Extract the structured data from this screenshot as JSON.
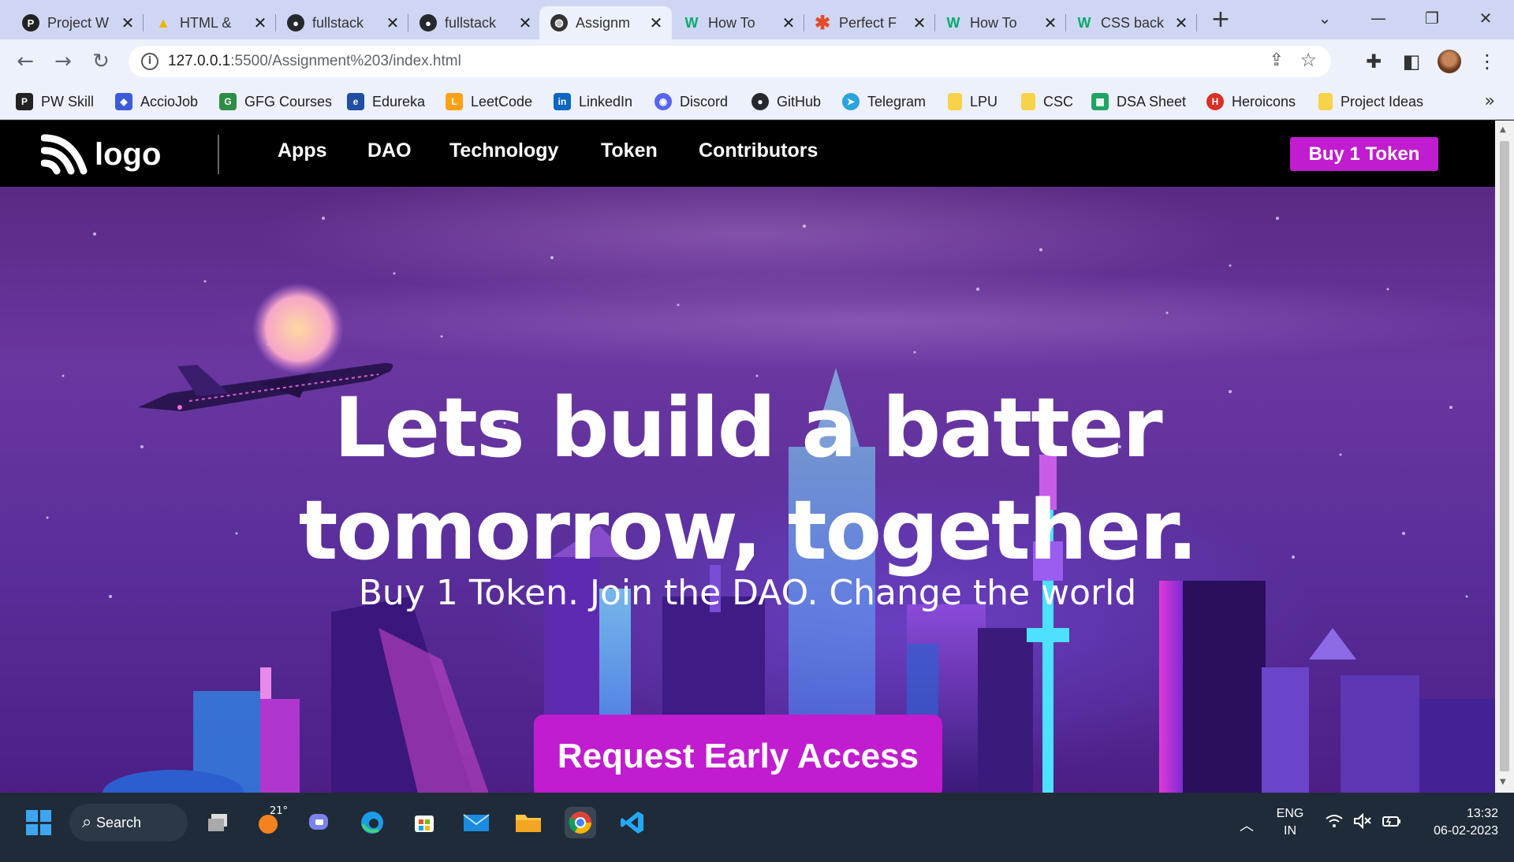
{
  "browser": {
    "tabs": [
      {
        "label": "Project W",
        "icon": "pw-skills-icon",
        "icon_bg": "#222222"
      },
      {
        "label": "HTML &",
        "icon": "google-drive-icon",
        "icon_bg": "#f4b400"
      },
      {
        "label": "fullstack",
        "icon": "github-icon",
        "icon_bg": "#24292e"
      },
      {
        "label": "fullstack",
        "icon": "github-icon",
        "icon_bg": "#24292e"
      },
      {
        "label": "Assignm",
        "icon": "globe-icon",
        "icon_bg": "#333333",
        "active": true
      },
      {
        "label": "How To",
        "icon": "w3schools-icon",
        "icon_bg": "#04aa6d"
      },
      {
        "label": "Perfect F",
        "icon": "asterisk-icon",
        "icon_bg": "#e34c26"
      },
      {
        "label": "How To",
        "icon": "w3schools-icon",
        "icon_bg": "#04aa6d"
      },
      {
        "label": "CSS back",
        "icon": "w3schools-icon",
        "icon_bg": "#04aa6d"
      }
    ],
    "new_tab": "+",
    "url_host": "127.0.0.1",
    "url_path": ":5500/Assignment%203/index.html",
    "bookmarks": [
      {
        "label": "PW Skill",
        "icon_bg": "#222222"
      },
      {
        "label": "AccioJob",
        "icon_bg": "#3b5bdb"
      },
      {
        "label": "GFG Courses",
        "icon_bg": "#2f8d46"
      },
      {
        "label": "Edureka",
        "icon_bg": "#1f4ea3"
      },
      {
        "label": "LeetCode",
        "icon_bg": "#ffa116"
      },
      {
        "label": "LinkedIn",
        "icon_bg": "#0a66c2"
      },
      {
        "label": "Discord",
        "icon_bg": "#5865f2"
      },
      {
        "label": "GitHub",
        "icon_bg": "#24292e"
      },
      {
        "label": "Telegram",
        "icon_bg": "#2aa3e0"
      },
      {
        "label": "LPU",
        "icon_bg": "#f7d24b"
      },
      {
        "label": "CSC",
        "icon_bg": "#f7d24b"
      },
      {
        "label": "DSA Sheet",
        "icon_bg": "#1fa463"
      },
      {
        "label": "Heroicons",
        "icon_bg": "#d93025"
      },
      {
        "label": "Project Ideas",
        "icon_bg": "#f7d24b"
      }
    ],
    "bookmarks_more": "»"
  },
  "site": {
    "logo_text": "logo",
    "nav": [
      "Apps",
      "DAO",
      "Technology",
      "Token",
      "Contributors"
    ],
    "buy_button": "Buy 1 Token",
    "headline_line1": "Lets build a batter",
    "headline_line2": "tomorrow, together.",
    "subline": "Buy 1 Token. Join the DAO. Change the world",
    "cta": "Request Early Access",
    "colors": {
      "accent": "#c11ccf",
      "nav_bg": "#000000",
      "hero_bg": "#5a2a83"
    }
  },
  "taskbar": {
    "search_label": "Search",
    "weather_temp": "21°",
    "lang_line1": "ENG",
    "lang_line2": "IN",
    "time": "13:32",
    "date": "06-02-2023"
  }
}
